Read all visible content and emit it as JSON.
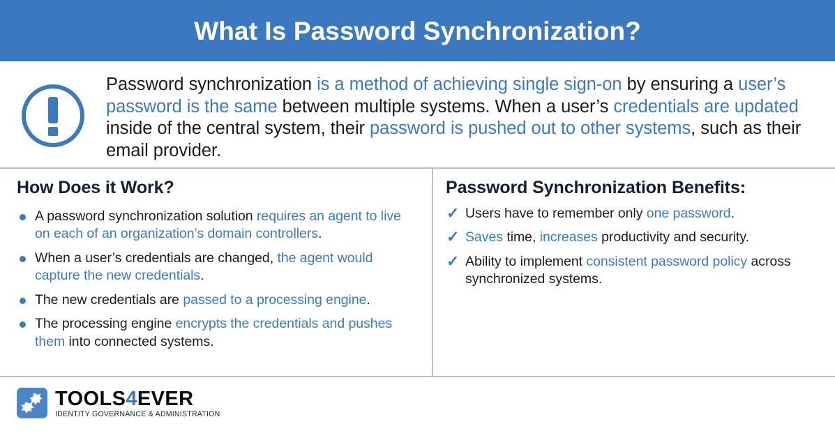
{
  "colors": {
    "header_band": "#3c78c0",
    "accent_blue": "#3d7ab8",
    "heading_dark": "#15212e",
    "body_text": "#1c1c1c",
    "divider": "#b9c1c8"
  },
  "header": {
    "title": "What Is Password Synchronization?"
  },
  "intro": {
    "icon": "exclamation-circle-icon",
    "segments": [
      {
        "text": "Password synchronization ",
        "accent": false
      },
      {
        "text": "is a method of achieving single sign-on",
        "accent": true
      },
      {
        "text": " by ensuring a ",
        "accent": false
      },
      {
        "text": "user’s password is the same",
        "accent": true
      },
      {
        "text": " between multiple systems. When a user’s ",
        "accent": false
      },
      {
        "text": "credentials are updated",
        "accent": true
      },
      {
        "text": " inside of the central system, their ",
        "accent": false
      },
      {
        "text": "password is pushed out to other systems",
        "accent": true
      },
      {
        "text": ", such as their email provider.",
        "accent": false
      }
    ]
  },
  "left_column": {
    "heading": "How Does it Work?",
    "bullet_style": "dot",
    "items": [
      {
        "segments": [
          {
            "text": "A password synchronization solution ",
            "accent": false
          },
          {
            "text": "requires an agent to live on each of an organization’s domain controllers",
            "accent": true
          },
          {
            "text": ".",
            "accent": false
          }
        ]
      },
      {
        "segments": [
          {
            "text": "When a user’s credentials are changed, ",
            "accent": false
          },
          {
            "text": "the agent would capture the new credentials",
            "accent": true
          },
          {
            "text": ".",
            "accent": false
          }
        ]
      },
      {
        "segments": [
          {
            "text": "The new credentials are ",
            "accent": false
          },
          {
            "text": "passed to a processing engine",
            "accent": true
          },
          {
            "text": ".",
            "accent": false
          }
        ]
      },
      {
        "segments": [
          {
            "text": "The processing engine ",
            "accent": false
          },
          {
            "text": "encrypts the credentials and pushes them",
            "accent": true
          },
          {
            "text": " into connected systems.",
            "accent": false
          }
        ]
      }
    ]
  },
  "right_column": {
    "heading": "Password Synchronization Benefits:",
    "bullet_style": "check",
    "check_glyph": "✓",
    "items": [
      {
        "segments": [
          {
            "text": "Users have to remember only ",
            "accent": false
          },
          {
            "text": "one password",
            "accent": true
          },
          {
            "text": ".",
            "accent": false
          }
        ]
      },
      {
        "segments": [
          {
            "text": "Saves",
            "accent": true
          },
          {
            "text": " time, ",
            "accent": false
          },
          {
            "text": "increases",
            "accent": true
          },
          {
            "text": " productivity and security.",
            "accent": false
          }
        ]
      },
      {
        "segments": [
          {
            "text": "Ability to implement ",
            "accent": false
          },
          {
            "text": "consistent password policy",
            "accent": true
          },
          {
            "text": " across synchronized systems.",
            "accent": false
          }
        ]
      }
    ]
  },
  "logo": {
    "mark": "tools4ever-gears-icon",
    "word_part1": "TOOLS",
    "word_accent": "4",
    "word_part2": "EVER",
    "tagline": "IDENTITY GOVERNANCE & ADMINISTRATION"
  }
}
